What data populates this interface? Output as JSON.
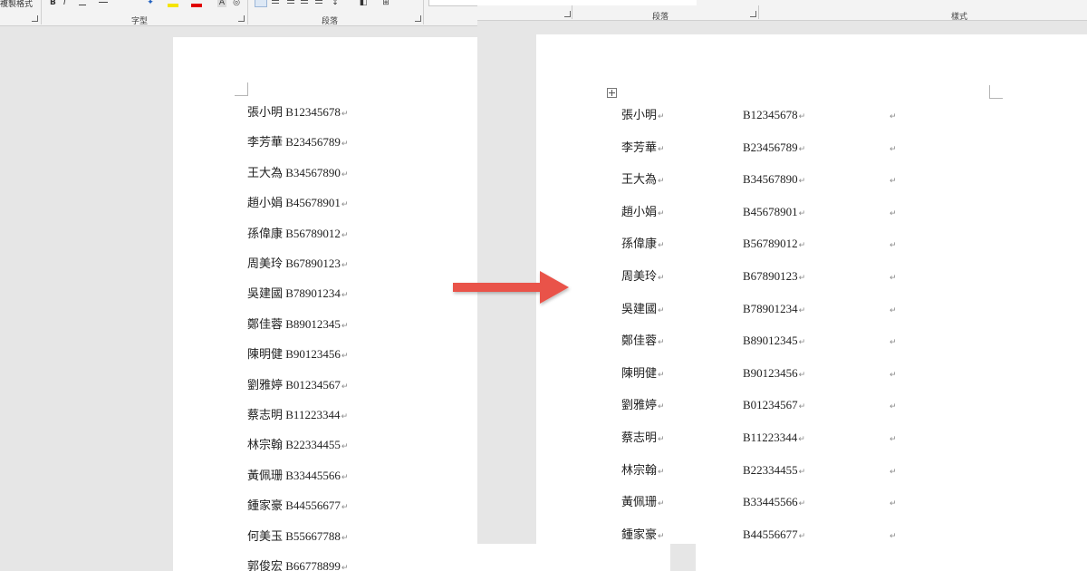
{
  "ribbon_left": {
    "copy_format_label": "複製格式",
    "font_group_label": "字型",
    "paragraph_group_label": "段落",
    "tool_glyphs": {
      "bold": "B",
      "italic": "I",
      "clear_format": "A"
    },
    "highlight_color": "#f5e400",
    "font_color": "#e00000"
  },
  "ribbon_right": {
    "paragraph_group_label": "段落",
    "styles_group_label": "樣式"
  },
  "paragraph_mark": "↵",
  "left_document": {
    "lines": [
      {
        "text": "張小明 B12345678"
      },
      {
        "text": "李芳華 B23456789"
      },
      {
        "text": "王大為 B34567890"
      },
      {
        "text": "趙小娟 B45678901"
      },
      {
        "text": "孫偉康 B56789012"
      },
      {
        "text": "周美玲 B67890123"
      },
      {
        "text": "吳建國 B78901234"
      },
      {
        "text": "鄭佳蓉 B89012345"
      },
      {
        "text": "陳明健 B90123456"
      },
      {
        "text": "劉雅婷 B01234567"
      },
      {
        "text": "蔡志明 B11223344"
      },
      {
        "text": "林宗翰 B22334455"
      },
      {
        "text": "黃佩珊 B33445566"
      },
      {
        "text": "鍾家豪 B44556677"
      },
      {
        "text": "何美玉 B55667788"
      },
      {
        "text": "郭俊宏 B66778899"
      }
    ]
  },
  "right_document": {
    "rows": [
      {
        "name": "張小明",
        "id": "B12345678"
      },
      {
        "name": "李芳華",
        "id": "B23456789"
      },
      {
        "name": "王大為",
        "id": "B34567890"
      },
      {
        "name": "趙小娟",
        "id": "B45678901"
      },
      {
        "name": "孫偉康",
        "id": "B56789012"
      },
      {
        "name": "周美玲",
        "id": "B67890123"
      },
      {
        "name": "吳建國",
        "id": "B78901234"
      },
      {
        "name": "鄭佳蓉",
        "id": "B89012345"
      },
      {
        "name": "陳明健",
        "id": "B90123456"
      },
      {
        "name": "劉雅婷",
        "id": "B01234567"
      },
      {
        "name": "蔡志明",
        "id": "B11223344"
      },
      {
        "name": "林宗翰",
        "id": "B22334455"
      },
      {
        "name": "黃佩珊",
        "id": "B33445566"
      },
      {
        "name": "鍾家豪",
        "id": "B44556677"
      }
    ]
  },
  "colors": {
    "arrow": "#e9524a",
    "workspace": "#e6e6e6",
    "page": "#ffffff"
  }
}
